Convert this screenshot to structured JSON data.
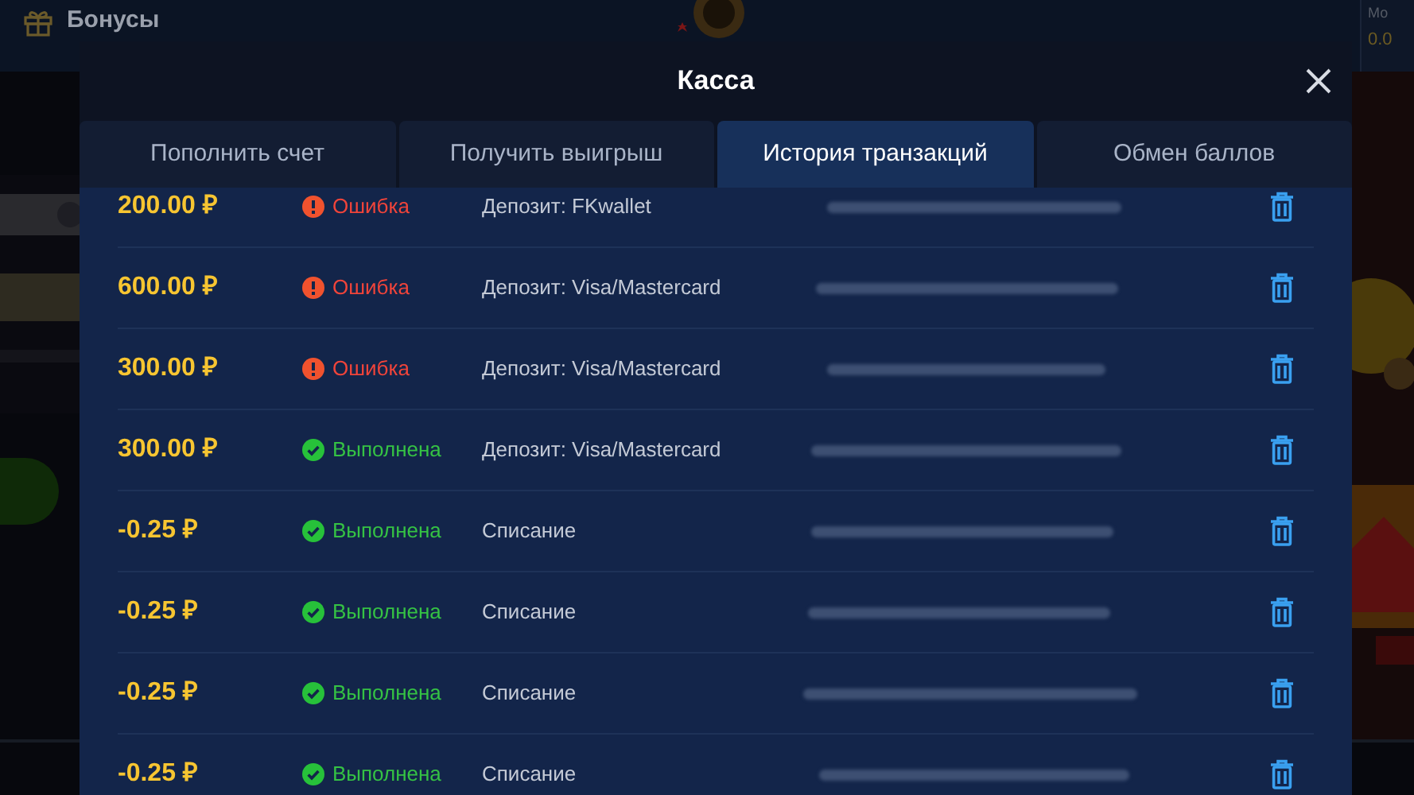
{
  "background": {
    "bonus_label": "Бонусы",
    "balance_label": "Мо",
    "balance_value": "0.0"
  },
  "modal": {
    "title": "Касса"
  },
  "tabs": [
    {
      "label": "Пополнить счет",
      "selected": false
    },
    {
      "label": "Получить выигрыш",
      "selected": false
    },
    {
      "label": "История транзакций",
      "selected": true
    },
    {
      "label": "Обмен баллов",
      "selected": false
    }
  ],
  "transactions": [
    {
      "amount": "200.00 ₽",
      "kind": "error",
      "status_label": "Ошибка",
      "description": "Депозит: FKwallet"
    },
    {
      "amount": "600.00 ₽",
      "kind": "error",
      "status_label": "Ошибка",
      "description": "Депозит: Visa/Mastercard"
    },
    {
      "amount": "300.00 ₽",
      "kind": "error",
      "status_label": "Ошибка",
      "description": "Депозит: Visa/Mastercard"
    },
    {
      "amount": "300.00 ₽",
      "kind": "done",
      "status_label": "Выполнена",
      "description": "Депозит: Visa/Mastercard"
    },
    {
      "amount": "-0.25 ₽",
      "kind": "done",
      "status_label": "Выполнена",
      "description": "Списание"
    },
    {
      "amount": "-0.25 ₽",
      "kind": "done",
      "status_label": "Выполнена",
      "description": "Списание"
    },
    {
      "amount": "-0.25 ₽",
      "kind": "done",
      "status_label": "Выполнена",
      "description": "Списание"
    },
    {
      "amount": "-0.25 ₽",
      "kind": "done",
      "status_label": "Выполнена",
      "description": "Списание"
    }
  ]
}
